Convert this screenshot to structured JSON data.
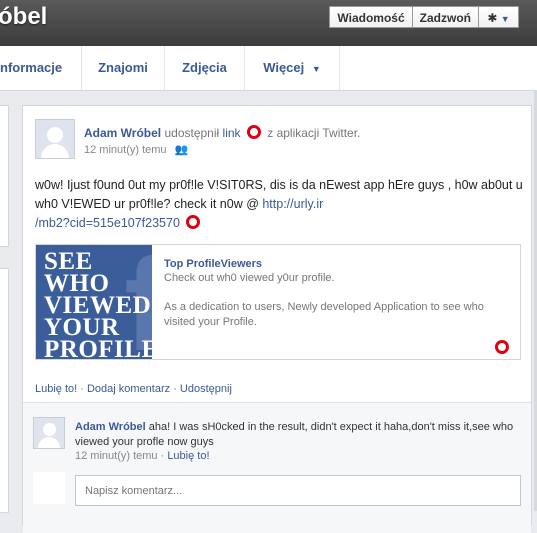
{
  "profile": {
    "name_fragment": "óbel"
  },
  "cover_actions": {
    "message_label": "Wiadomość",
    "call_label": "Zadzwoń",
    "gear_icon": "gear-icon",
    "gear_caret": "▼"
  },
  "nav": {
    "tabs": [
      {
        "label": "nformacje"
      },
      {
        "label": "Znajomi"
      },
      {
        "label": "Zdjęcia"
      },
      {
        "label": "Więcej"
      }
    ],
    "more_caret": "▼"
  },
  "post": {
    "author": "Adam Wróbel",
    "action_prefix": "udostępnił",
    "action_link": "link",
    "action_suffix": "z aplikacji Twitter.",
    "time": "12 minut(y) temu",
    "body_text": "w0w! Ijust f0und 0ut my pr0f!le V!SIT0RS, dis is da nEwest app hEre guys , h0w ab0ut u wh0 V!EWED ur pr0f!le? check it n0w @ ",
    "url_part1": "http://urly.ir",
    "url_part2": "/mb2?cid=515e107f23570",
    "preview": {
      "image_lines": [
        "SEE",
        "WHO",
        "VIEWED",
        "YOUR",
        "PROFILE"
      ],
      "title": "Top ProfileViewers",
      "subtitle": "Check out wh0 viewed y0ur profile.",
      "description": "As a dedication to users, Newly developed Application to see who visited your Profile."
    },
    "actions": {
      "like": "Lubię to!",
      "comment": "Dodaj komentarz",
      "share": "Udostępnij",
      "sep": " · "
    }
  },
  "comment": {
    "author": "Adam Wróbel",
    "text": "aha! I was sH0cked in the result, didn't expect it haha,don't miss it,see who viewed your profle now guys",
    "time": "12 minut(y) temu",
    "sep": " · ",
    "like": "Lubię to!",
    "input_placeholder": "Napisz komentarz..."
  },
  "colors": {
    "brand": "#3b5998",
    "marker": "#e0000f"
  }
}
